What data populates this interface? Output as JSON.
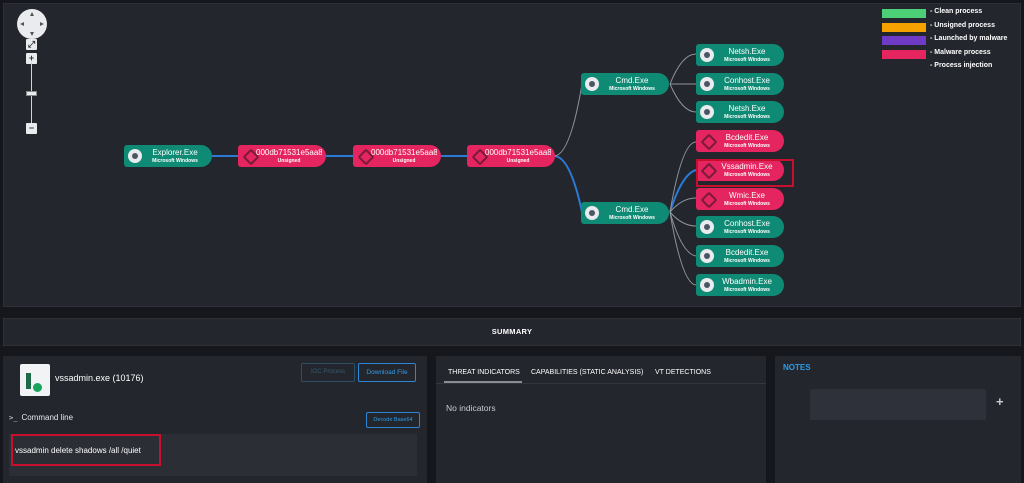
{
  "legend": [
    {
      "label": "- Clean process",
      "color": "#4ccf77"
    },
    {
      "label": "- Unsigned process",
      "color": "#f5a100"
    },
    {
      "label": "- Launched by malware",
      "color": "#6f3bc6"
    },
    {
      "label": "- Malware process",
      "color": "#e4255f"
    },
    {
      "label": "- Process injection",
      "color": ""
    }
  ],
  "nodes": {
    "explorer": {
      "name": "Explorer.Exe",
      "sub": "Microsoft Windows"
    },
    "mal1": {
      "name": "000db71531e5aa8...",
      "sub": "Unsigned"
    },
    "mal2": {
      "name": "000db71531e5aa8...",
      "sub": "Unsigned"
    },
    "mal3": {
      "name": "000db71531e5aa8...",
      "sub": "Unsigned"
    },
    "cmd1": {
      "name": "Cmd.Exe",
      "sub": "Microsoft Windows"
    },
    "cmd2": {
      "name": "Cmd.Exe",
      "sub": "Microsoft Windows"
    },
    "netsh1": {
      "name": "Netsh.Exe",
      "sub": "Microsoft Windows"
    },
    "conhost1": {
      "name": "Conhost.Exe",
      "sub": "Microsoft Windows"
    },
    "netsh2": {
      "name": "Netsh.Exe",
      "sub": "Microsoft Windows"
    },
    "bcdedit1": {
      "name": "Bcdedit.Exe",
      "sub": "Microsoft Windows"
    },
    "vssadmin": {
      "name": "Vssadmin.Exe",
      "sub": "Microsoft Windows"
    },
    "wmic": {
      "name": "Wmic.Exe",
      "sub": "Microsoft Windows"
    },
    "conhost2": {
      "name": "Conhost.Exe",
      "sub": "Microsoft Windows"
    },
    "bcdedit2": {
      "name": "Bcdedit.Exe",
      "sub": "Microsoft Windows"
    },
    "wbadmin": {
      "name": "Wbadmin.Exe",
      "sub": "Microsoft Windows"
    }
  },
  "summary": {
    "title": "SUMMARY"
  },
  "process": {
    "title": "vssadmin.exe (10176)",
    "disabled_button": "IOC Process",
    "download_button": "Download File",
    "cmd_label": "Command line",
    "cmd_prompt": ">_",
    "decode_button": "Decode Base64",
    "command": "vssadmin delete shadows /all /quiet"
  },
  "tabs": [
    "THREAT INDICATORS",
    "CAPABILITIES (STATIC ANALYSIS)",
    "VT DETECTIONS"
  ],
  "indicators": {
    "empty": "No indicators"
  },
  "notes": {
    "title": "NOTES",
    "add": "+"
  }
}
